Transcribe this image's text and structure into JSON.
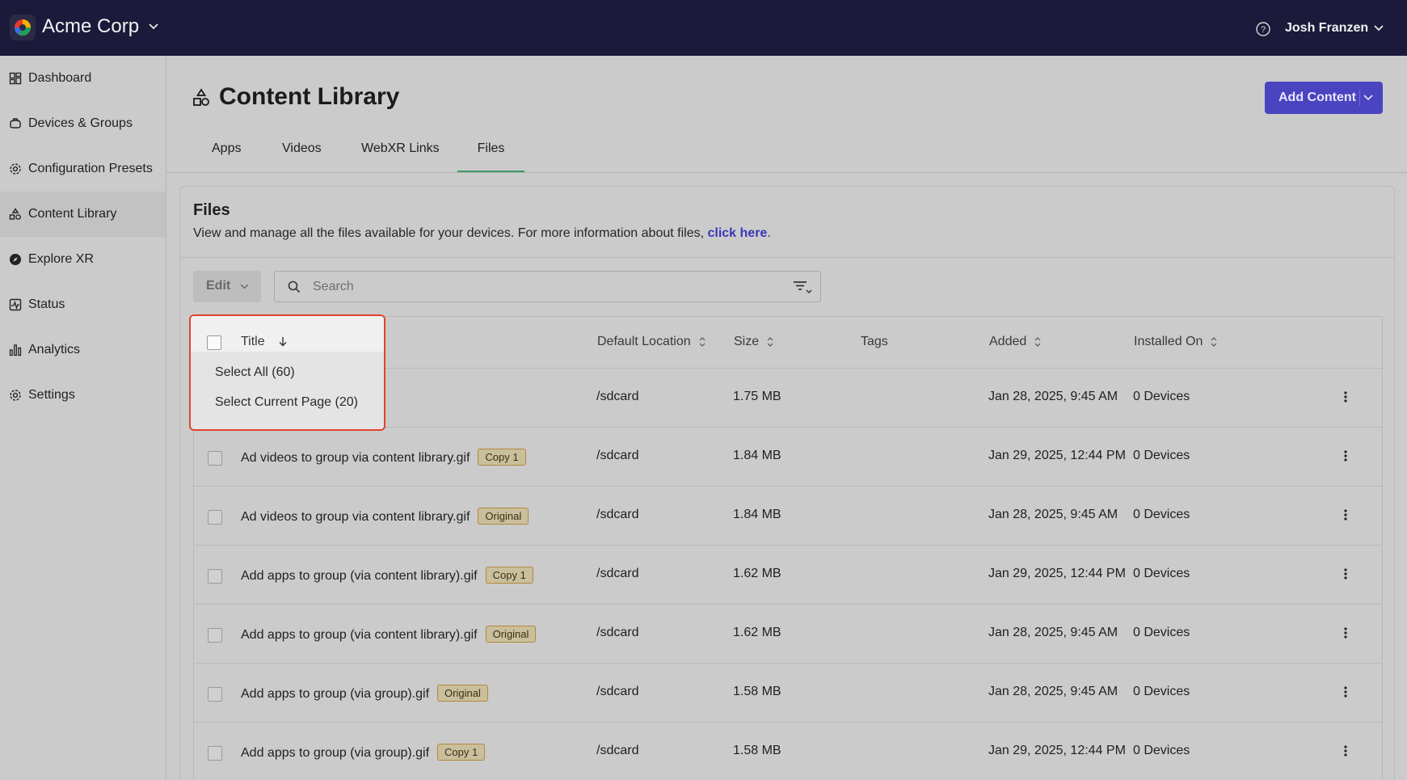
{
  "topbar": {
    "org_name": "Acme Corp",
    "user_name": "Josh Franzen"
  },
  "sidebar": {
    "items": [
      {
        "label": "Dashboard",
        "icon": "dashboard-icon"
      },
      {
        "label": "Devices & Groups",
        "icon": "devices-icon"
      },
      {
        "label": "Configuration Presets",
        "icon": "gear-icon"
      },
      {
        "label": "Content Library",
        "icon": "shapes-icon",
        "active": true
      },
      {
        "label": "Explore XR",
        "icon": "compass-icon"
      },
      {
        "label": "Status",
        "icon": "status-icon"
      },
      {
        "label": "Analytics",
        "icon": "analytics-icon"
      },
      {
        "label": "Settings",
        "icon": "gear-icon"
      }
    ]
  },
  "header": {
    "title": "Content Library",
    "add_button": "Add Content"
  },
  "tabs": [
    "Apps",
    "Videos",
    "WebXR Links",
    "Files"
  ],
  "active_tab": "Files",
  "files": {
    "title": "Files",
    "description": "View and manage all the files available for your devices. For more information about files, ",
    "link_text": "click here",
    "period": ".",
    "edit_label": "Edit",
    "search_placeholder": "Search"
  },
  "table": {
    "columns": [
      "Title",
      "Default Location",
      "Size",
      "Tags",
      "Added",
      "Installed On"
    ],
    "rows": [
      {
        "title": "",
        "badge": "",
        "location": "/sdcard",
        "size": "1.75 MB",
        "tags": "",
        "added": "Jan 28, 2025, 9:45 AM",
        "installed": "0 Devices"
      },
      {
        "title": "Ad videos to group via content library.gif",
        "badge": "Copy 1",
        "location": "/sdcard",
        "size": "1.84 MB",
        "tags": "",
        "added": "Jan 29, 2025, 12:44 PM",
        "installed": "0 Devices"
      },
      {
        "title": "Ad videos to group via content library.gif",
        "badge": "Original",
        "location": "/sdcard",
        "size": "1.84 MB",
        "tags": "",
        "added": "Jan 28, 2025, 9:45 AM",
        "installed": "0 Devices"
      },
      {
        "title": "Add apps to group (via content library).gif",
        "badge": "Copy 1",
        "location": "/sdcard",
        "size": "1.62 MB",
        "tags": "",
        "added": "Jan 29, 2025, 12:44 PM",
        "installed": "0 Devices"
      },
      {
        "title": "Add apps to group (via content library).gif",
        "badge": "Original",
        "location": "/sdcard",
        "size": "1.62 MB",
        "tags": "",
        "added": "Jan 28, 2025, 9:45 AM",
        "installed": "0 Devices"
      },
      {
        "title": "Add apps to group (via group).gif",
        "badge": "Original",
        "location": "/sdcard",
        "size": "1.58 MB",
        "tags": "",
        "added": "Jan 28, 2025, 9:45 AM",
        "installed": "0 Devices"
      },
      {
        "title": "Add apps to group (via group).gif",
        "badge": "Copy 1",
        "location": "/sdcard",
        "size": "1.58 MB",
        "tags": "",
        "added": "Jan 29, 2025, 12:44 PM",
        "installed": "0 Devices"
      }
    ]
  },
  "select_dropdown": {
    "header_label": "Title",
    "options": [
      "Select All (60)",
      "Select Current Page (20)"
    ]
  },
  "colors": {
    "topbar": "#1b1a3a",
    "accent": "#4b44c0",
    "highlight": "#e0452d",
    "active_tab": "#3d9a62"
  }
}
